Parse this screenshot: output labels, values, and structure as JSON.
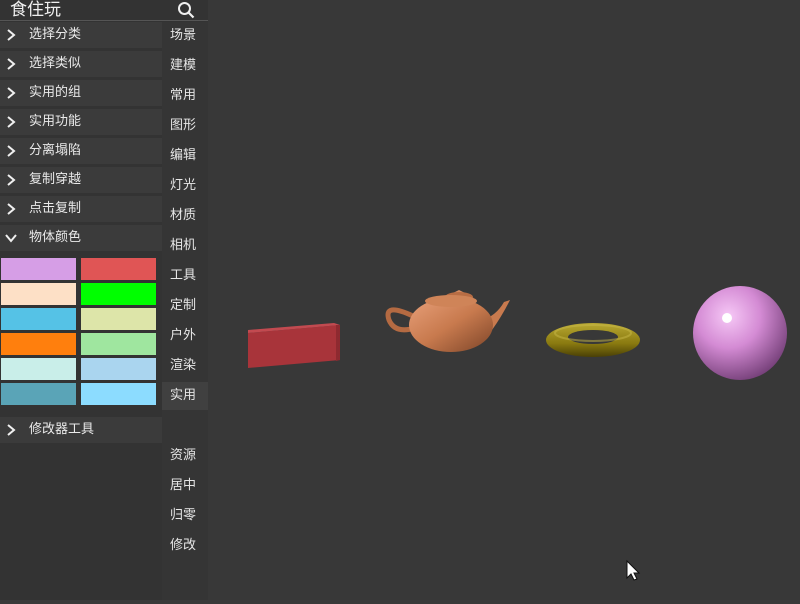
{
  "app": {
    "title": "食住玩"
  },
  "search": {
    "icon": "search-icon"
  },
  "categories": [
    {
      "label": "选择分类",
      "expanded": false
    },
    {
      "label": "选择类似",
      "expanded": false
    },
    {
      "label": "实用的组",
      "expanded": false
    },
    {
      "label": "实用功能",
      "expanded": false
    },
    {
      "label": "分离塌陷",
      "expanded": false
    },
    {
      "label": "复制穿越",
      "expanded": false
    },
    {
      "label": "点击复制",
      "expanded": false
    },
    {
      "label": "物体颜色",
      "expanded": true
    }
  ],
  "object_colors": [
    "#d69ee6",
    "#e05555",
    "#fde0c6",
    "#00ff00",
    "#55c2e6",
    "#dde5a9",
    "#ff7f0d",
    "#9fe69f",
    "#c9eee9",
    "#aad5ef",
    "#5aa4b7",
    "#8cdcff"
  ],
  "modifier": {
    "label": "修改器工具",
    "expanded": false
  },
  "side_tabs": [
    {
      "label": "场景"
    },
    {
      "label": "建模"
    },
    {
      "label": "常用"
    },
    {
      "label": "图形"
    },
    {
      "label": "编辑"
    },
    {
      "label": "灯光"
    },
    {
      "label": "材质"
    },
    {
      "label": "相机"
    },
    {
      "label": "工具"
    },
    {
      "label": "定制"
    },
    {
      "label": "户外"
    },
    {
      "label": "渲染"
    },
    {
      "label": "实用",
      "active": true
    }
  ],
  "side_tabs_bottom": [
    {
      "label": "资源"
    },
    {
      "label": "居中"
    },
    {
      "label": "归零"
    },
    {
      "label": "修改"
    }
  ],
  "scene_objects": [
    {
      "name": "box",
      "color": "#b4393e"
    },
    {
      "name": "teapot",
      "color": "#c87a4e"
    },
    {
      "name": "torus",
      "color": "#8a7a10"
    },
    {
      "name": "sphere",
      "color": "#d48bd4"
    }
  ]
}
